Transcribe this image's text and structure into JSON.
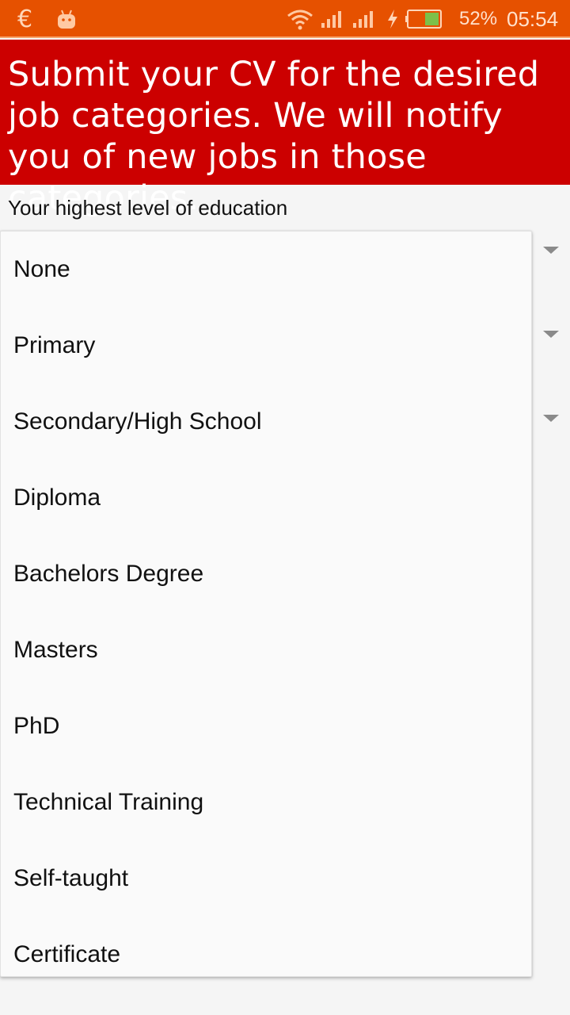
{
  "status_bar": {
    "battery_percent": "52%",
    "time": "05:54",
    "icons": [
      "euro-icon",
      "android-icon",
      "wifi-icon",
      "signal-icon",
      "signal-icon",
      "charging-icon",
      "battery-icon"
    ],
    "color": "#e65100"
  },
  "banner": {
    "text": "Submit your CV for the desired job categories. We will notify you of new jobs in those categories.",
    "color": "#cc0000"
  },
  "education": {
    "label": "Your highest level of education",
    "options": [
      "None",
      "Primary",
      "Secondary/High School",
      "Diploma",
      "Bachelors Degree",
      "Masters",
      "PhD",
      "Technical Training",
      "Self-taught",
      "Certificate"
    ]
  }
}
